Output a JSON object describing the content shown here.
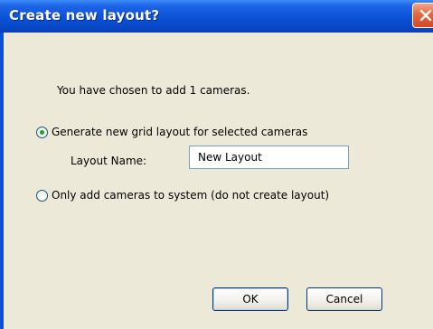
{
  "window": {
    "title": "Create new layout?"
  },
  "dialog": {
    "message": "You have chosen to add 1 cameras.",
    "options": [
      {
        "label": "Generate new grid layout for selected cameras",
        "selected": true
      },
      {
        "label": "Only add cameras to system (do not create layout)",
        "selected": false
      }
    ],
    "layout_name": {
      "label": "Layout Name:",
      "value": "New Layout"
    }
  },
  "buttons": {
    "ok_label": "OK",
    "cancel_label": "Cancel"
  },
  "icons": {
    "close": "close-icon"
  },
  "colors": {
    "titlebar": "#0A52D8",
    "client_background": "#ECE9D8",
    "close_button": "#E4673D",
    "radio_selected_dot": "#21A121"
  }
}
